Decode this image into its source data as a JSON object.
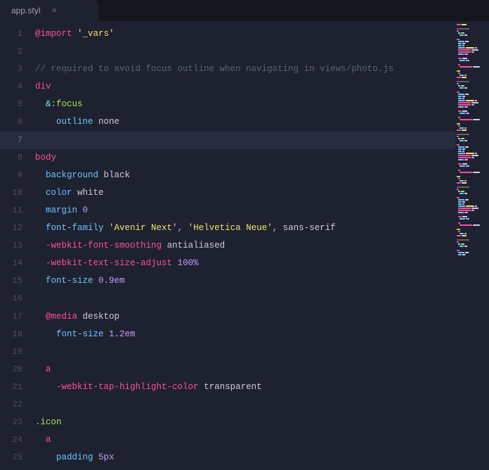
{
  "tab": {
    "label": "app.styl"
  },
  "currentLine": 7,
  "lines": [
    {
      "n": 1,
      "indent": 0,
      "tokens": [
        [
          "keyword",
          "@import"
        ],
        [
          "punct",
          " "
        ],
        [
          "str",
          "'_vars'"
        ]
      ]
    },
    {
      "n": 2,
      "indent": 0,
      "tokens": []
    },
    {
      "n": 3,
      "indent": 0,
      "tokens": [
        [
          "comment",
          "// required to avoid focus outline when navigating in views/photo.js"
        ]
      ]
    },
    {
      "n": 4,
      "indent": 0,
      "tokens": [
        [
          "tag",
          "div"
        ]
      ]
    },
    {
      "n": 5,
      "indent": 1,
      "tokens": [
        [
          "amp",
          "&"
        ],
        [
          "pseudo",
          ":focus"
        ]
      ]
    },
    {
      "n": 6,
      "indent": 2,
      "tokens": [
        [
          "prop",
          "outline"
        ],
        [
          "punct",
          " "
        ],
        [
          "val",
          "none"
        ]
      ]
    },
    {
      "n": 7,
      "indent": 0,
      "tokens": []
    },
    {
      "n": 8,
      "indent": 0,
      "tokens": [
        [
          "tag",
          "body"
        ]
      ]
    },
    {
      "n": 9,
      "indent": 1,
      "tokens": [
        [
          "prop",
          "background"
        ],
        [
          "punct",
          " "
        ],
        [
          "val",
          "black"
        ]
      ]
    },
    {
      "n": 10,
      "indent": 1,
      "tokens": [
        [
          "prop",
          "color"
        ],
        [
          "punct",
          " "
        ],
        [
          "val",
          "white"
        ]
      ]
    },
    {
      "n": 11,
      "indent": 1,
      "tokens": [
        [
          "prop",
          "margin"
        ],
        [
          "punct",
          " "
        ],
        [
          "num",
          "0"
        ]
      ]
    },
    {
      "n": 12,
      "indent": 1,
      "tokens": [
        [
          "prop",
          "font-family"
        ],
        [
          "punct",
          " "
        ],
        [
          "str",
          "'Avenir Next'"
        ],
        [
          "punct",
          ", "
        ],
        [
          "str",
          "'Helvetica Neue'"
        ],
        [
          "punct",
          ", "
        ],
        [
          "val",
          "sans-serif"
        ]
      ]
    },
    {
      "n": 13,
      "indent": 1,
      "tokens": [
        [
          "propv",
          "-webkit-font-smoothing"
        ],
        [
          "punct",
          " "
        ],
        [
          "val",
          "antialiased"
        ]
      ]
    },
    {
      "n": 14,
      "indent": 1,
      "tokens": [
        [
          "propv",
          "-webkit-text-size-adjust"
        ],
        [
          "punct",
          " "
        ],
        [
          "num",
          "100%"
        ]
      ]
    },
    {
      "n": 15,
      "indent": 1,
      "tokens": [
        [
          "prop",
          "font-size"
        ],
        [
          "punct",
          " "
        ],
        [
          "num",
          "0.9em"
        ]
      ]
    },
    {
      "n": 16,
      "indent": 0,
      "tokens": []
    },
    {
      "n": 17,
      "indent": 1,
      "tokens": [
        [
          "keyword",
          "@media"
        ],
        [
          "punct",
          " "
        ],
        [
          "media",
          "desktop"
        ]
      ]
    },
    {
      "n": 18,
      "indent": 2,
      "tokens": [
        [
          "prop",
          "font-size"
        ],
        [
          "punct",
          " "
        ],
        [
          "num",
          "1.2em"
        ]
      ]
    },
    {
      "n": 19,
      "indent": 0,
      "tokens": []
    },
    {
      "n": 20,
      "indent": 1,
      "tokens": [
        [
          "tag",
          "a"
        ]
      ]
    },
    {
      "n": 21,
      "indent": 2,
      "tokens": [
        [
          "propv",
          "-webkit-tap-highlight-color"
        ],
        [
          "punct",
          " "
        ],
        [
          "val",
          "transparent"
        ]
      ]
    },
    {
      "n": 22,
      "indent": 0,
      "tokens": []
    },
    {
      "n": 23,
      "indent": 0,
      "tokens": [
        [
          "class",
          ".icon"
        ]
      ]
    },
    {
      "n": 24,
      "indent": 1,
      "tokens": [
        [
          "tag",
          "a"
        ]
      ]
    },
    {
      "n": 25,
      "indent": 2,
      "tokens": [
        [
          "prop",
          "padding"
        ],
        [
          "punct",
          " "
        ],
        [
          "num",
          "5px"
        ]
      ]
    }
  ],
  "tokenColors": {
    "keyword": "#ff4f9a",
    "tag": "#ff4f9a",
    "class": "#a8e24a",
    "pseudo": "#a8e24a",
    "amp": "#7fe0ff",
    "prop": "#6ac7ff",
    "propv": "#ff4f9a",
    "val": "#cfcde0",
    "str": "#f5e26b",
    "num": "#c99cff",
    "punct": "#babcc8",
    "comment": "#5d6176",
    "media": "#cfcde0"
  },
  "minimapDensity": 110
}
